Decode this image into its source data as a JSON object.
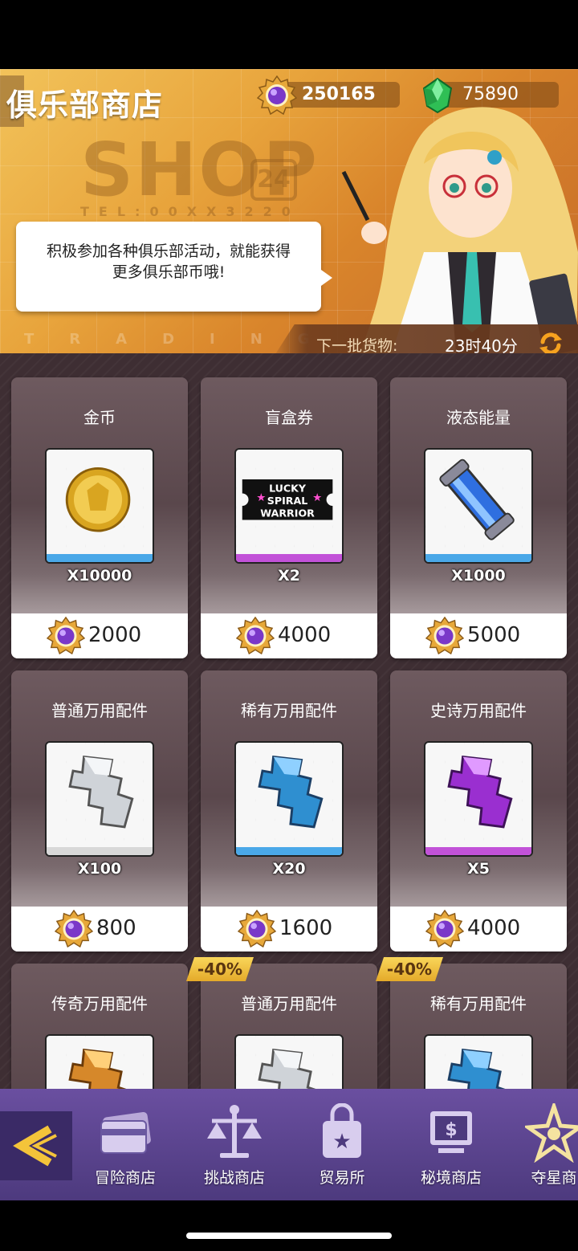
{
  "header": {
    "title": "俱乐部商店",
    "bg_word": "SHOP",
    "bg_badge": "24",
    "bg_tel": "TEL:00XX3220",
    "bg_trading": "TRADING",
    "club_coins": "250165",
    "gems": "75890",
    "tip": [
      "积极参加各种俱乐部活动，就能获得",
      "更多俱乐部币哦!"
    ],
    "restock_label": "下一批货物:",
    "restock_time": "23时40分"
  },
  "items": [
    {
      "name": "金币",
      "qty": "X10000",
      "price": "2000",
      "rarity_color": "#4aa8e8",
      "icon": "gold-coin-icon"
    },
    {
      "name": "盲盒券",
      "qty": "X2",
      "price": "4000",
      "rarity_color": "#c252d8",
      "icon": "blind-box-ticket-icon",
      "ticket_text": [
        "LUCKY",
        "SPIRAL",
        "WARRIOR"
      ]
    },
    {
      "name": "液态能量",
      "qty": "X1000",
      "price": "5000",
      "rarity_color": "#4aa8e8",
      "icon": "liquid-energy-icon"
    },
    {
      "name": "普通万用配件",
      "qty": "X100",
      "price": "800",
      "rarity_color": "#d8d8d8",
      "icon": "common-part-icon"
    },
    {
      "name": "稀有万用配件",
      "qty": "X20",
      "price": "1600",
      "rarity_color": "#4aa8e8",
      "icon": "rare-part-icon"
    },
    {
      "name": "史诗万用配件",
      "qty": "X5",
      "price": "4000",
      "rarity_color": "#c252d8",
      "icon": "epic-part-icon"
    },
    {
      "name": "传奇万用配件",
      "qty": "",
      "price": "",
      "rarity_color": "#e8a030",
      "icon": "legendary-part-icon"
    },
    {
      "name": "普通万用配件",
      "qty": "",
      "price": "",
      "rarity_color": "#d8d8d8",
      "icon": "common-part-icon",
      "discount": "-40%"
    },
    {
      "name": "稀有万用配件",
      "qty": "",
      "price": "",
      "rarity_color": "#4aa8e8",
      "icon": "rare-part-icon",
      "discount": "-40%"
    }
  ],
  "nav": [
    {
      "label": "冒险商店",
      "icon": "card-icon"
    },
    {
      "label": "挑战商店",
      "icon": "scales-icon"
    },
    {
      "label": "贸易所",
      "icon": "bag-star-icon"
    },
    {
      "label": "秘境商店",
      "icon": "dollar-screen-icon"
    },
    {
      "label": "夺星商",
      "icon": "star-burst-icon"
    }
  ]
}
